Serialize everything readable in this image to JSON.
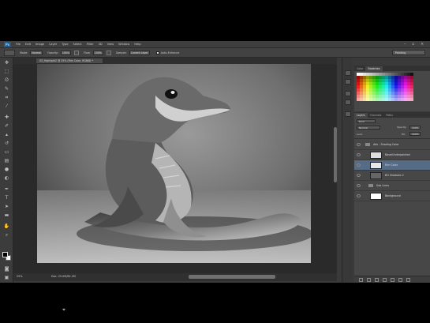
{
  "menu": {
    "logo": "Ps",
    "items": [
      "File",
      "Edit",
      "Image",
      "Layer",
      "Type",
      "Select",
      "Filter",
      "3D",
      "View",
      "Window",
      "Help"
    ]
  },
  "options": {
    "mode_label": "Mode:",
    "mode_value": "Normal",
    "opacity_label": "Opacity:",
    "opacity_value": "100%",
    "flow_label": "Flow:",
    "flow_value": "100%",
    "sample_label": "Sample:",
    "sample_value": "Current Layer",
    "auto_label": "Auto-Enhance",
    "workspace": "Painting"
  },
  "document": {
    "tab_title": "03_Highlight2 @ 25% (Rim Color, RGB/8) *",
    "zoom": "25%",
    "doc_info": "Doc: 25.0M/82.2M"
  },
  "swatches_panel": {
    "tabs": [
      "Color",
      "Swatches"
    ]
  },
  "layers_panel": {
    "tabs": [
      "Layers",
      "Channels",
      "Paths"
    ],
    "kind_label": "Kind",
    "blend_mode": "Normal",
    "opacity_label": "Opacity:",
    "opacity_value": "100%",
    "lock_label": "Lock:",
    "fill_label": "Fill:",
    "fill_value": "100%",
    "group_name": "Adv - Shading Color",
    "layers": [
      {
        "name": "Base/Underpainted",
        "selected": false
      },
      {
        "name": "Rim Color",
        "selected": true
      },
      {
        "name": "BG Shadows 2",
        "selected": false
      }
    ],
    "subgroup_name": "Sub Lines",
    "background_name": "Background"
  },
  "colors": {
    "accent_select": "#566b86",
    "ui_dark": "#3a3a3a"
  },
  "icons": {
    "tools": [
      "move-icon",
      "marquee-icon",
      "lasso-icon",
      "quick-select-icon",
      "crop-icon",
      "eyedropper-icon",
      "healing-icon",
      "brush-icon",
      "clone-stamp-icon",
      "history-brush-icon",
      "eraser-icon",
      "gradient-icon",
      "blur-icon",
      "dodge-icon",
      "pen-icon",
      "type-icon",
      "path-select-icon",
      "shape-icon",
      "hand-icon",
      "zoom-icon"
    ]
  }
}
